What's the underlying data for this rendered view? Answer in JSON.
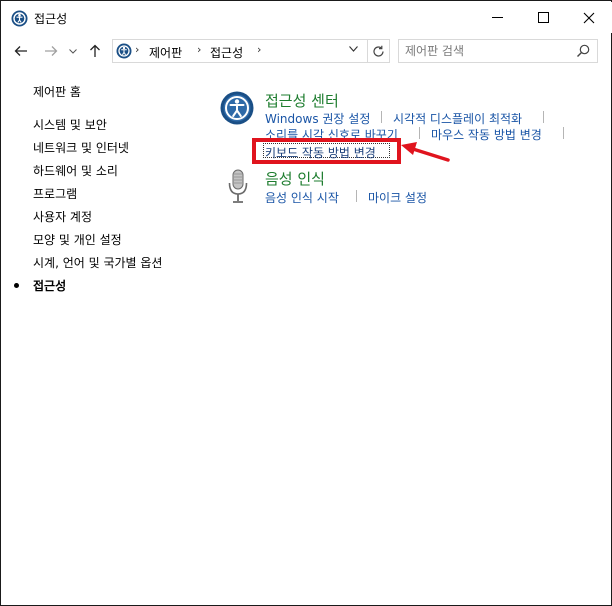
{
  "window": {
    "title": "접근성",
    "controls": {
      "minimize": "minimize-icon",
      "maximize": "maximize-icon",
      "close": "close-icon"
    }
  },
  "navigation": {
    "icons": [
      "back-arrow-icon",
      "forward-arrow-icon",
      "recent-dropdown-icon",
      "up-arrow-icon"
    ]
  },
  "address_bar": {
    "breadcrumbs": [
      "제어판",
      "접근성"
    ],
    "icons": [
      "control-panel-icon",
      "chevron-right-icon",
      "dropdown-icon",
      "refresh-icon"
    ]
  },
  "search": {
    "placeholder": "제어판 검색",
    "icon": "search-icon"
  },
  "sidebar": {
    "home": "제어판 홈",
    "items": [
      {
        "label": "시스템 및 보안"
      },
      {
        "label": "네트워크 및 인터넷"
      },
      {
        "label": "하드웨어 및 소리"
      },
      {
        "label": "프로그램"
      },
      {
        "label": "사용자 계정"
      },
      {
        "label": "모양 및 개인 설정"
      },
      {
        "label": "시계, 언어 및 국가별 옵션"
      },
      {
        "label": "접근성",
        "current": true
      }
    ]
  },
  "main": {
    "sections": [
      {
        "title": "접근성 센터",
        "icon": "ease-of-access-icon",
        "links": [
          "Windows 권장 설정",
          "시각적 디스플레이 최적화",
          "소리를 시각 신호로 바꾸기",
          "마우스 작동 방법 변경",
          "키보드 작동 방법 변경"
        ]
      },
      {
        "title": "음성 인식",
        "icon": "microphone-icon",
        "links": [
          "음성 인식 시작",
          "마이크 설정"
        ]
      }
    ]
  },
  "annotation": {
    "highlight_color": "#e0141e",
    "arrow_icon": "red-arrow-icon"
  },
  "colors": {
    "section_title": "#1e7d2f",
    "link": "#1a55a6",
    "icon_blue": "#1a4f86"
  }
}
